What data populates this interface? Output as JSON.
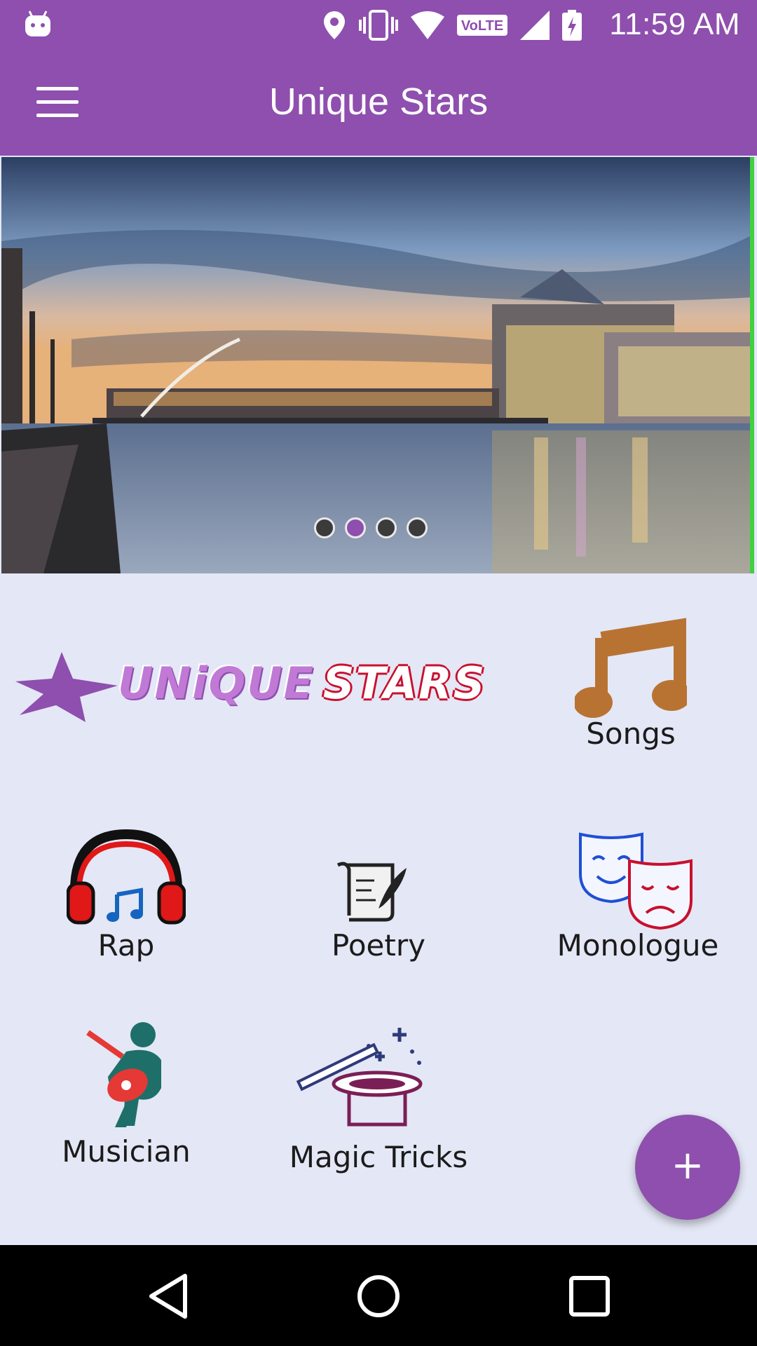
{
  "status_bar": {
    "time": "11:59 AM",
    "volte_label": "VoLTE",
    "icons": [
      "android-icon",
      "location-icon",
      "vibrate-icon",
      "wifi-icon",
      "volte-icon",
      "signal-icon",
      "battery-charging-icon"
    ]
  },
  "app_bar": {
    "title": "Unique Stars",
    "menu_icon": "hamburger-menu-icon"
  },
  "banner": {
    "image": "city-river-night-skyline",
    "dots_count": 4,
    "active_dot_index": 1
  },
  "logo": {
    "word1": "UNiQUE",
    "word2": "STARS"
  },
  "categories": [
    {
      "label": "Songs",
      "icon": "music-note-icon"
    },
    {
      "label": "Rap",
      "icon": "headphones-icon"
    },
    {
      "label": "Poetry",
      "icon": "scroll-quill-icon"
    },
    {
      "label": "Monologue",
      "icon": "theater-masks-icon"
    },
    {
      "label": "Musician",
      "icon": "guitarist-icon"
    },
    {
      "label": "Magic Tricks",
      "icon": "magic-hat-wand-icon"
    }
  ],
  "fab": {
    "label": "+"
  },
  "nav_bar": {
    "icons": [
      "back-icon",
      "home-icon",
      "recents-icon"
    ]
  },
  "colors": {
    "primary": "#8e4fae",
    "background": "#e4e7f5",
    "accent_red": "#c8102e"
  }
}
